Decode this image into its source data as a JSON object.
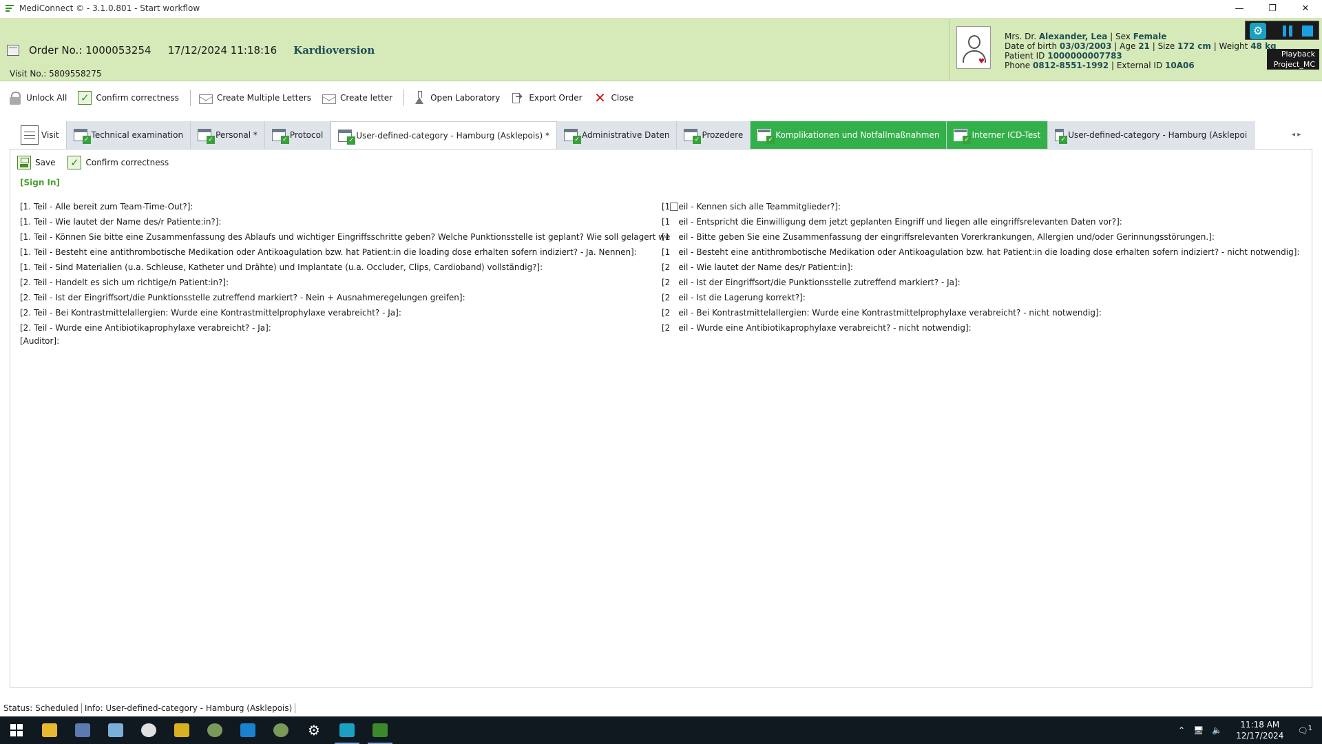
{
  "window": {
    "title": "MediConnect © - 3.1.0.801 - Start workflow",
    "minimize": "—",
    "restore": "❐",
    "close": "✕"
  },
  "order": {
    "number_label": "Order No.: 1000053254",
    "datetime": "17/12/2024 11:18:16",
    "type": "Kardioversion",
    "visit_label": "Visit No.: 5809558275"
  },
  "patient": {
    "title_name_prefix": "Mrs. Dr.",
    "name": "Alexander, Lea",
    "sex_label": "Sex",
    "sex": "Female",
    "dob_label": "Date of birth",
    "dob": "03/03/2003",
    "age_label": "Age",
    "age": "21",
    "size_label": "Size",
    "size": "172 cm",
    "weight_label": "Weight",
    "weight": "48 kg",
    "patient_id_label": "Patient ID",
    "patient_id": "1000000007783",
    "phone_label": "Phone",
    "phone": "0812-8551-1992",
    "external_id_label": "External ID",
    "external_id": "10A06"
  },
  "widget": {
    "playback_label": "Playback",
    "project_label": "Project_MC"
  },
  "toolbar": {
    "unlock_all": "Unlock All",
    "confirm_correctness": "Confirm correctness",
    "create_multiple_letters": "Create Multiple Letters",
    "create_letter": "Create letter",
    "open_laboratory": "Open Laboratory",
    "export_order": "Export Order",
    "close": "Close"
  },
  "tabs": [
    {
      "label": "Visit",
      "state": "normal"
    },
    {
      "label": "Technical examination",
      "state": "normal"
    },
    {
      "label": "Personal *",
      "state": "normal"
    },
    {
      "label": "Protocol",
      "state": "normal"
    },
    {
      "label": "User-defined-category - Hamburg (Asklepois) *",
      "state": "active"
    },
    {
      "label": "Administrative Daten",
      "state": "normal"
    },
    {
      "label": "Prozedere",
      "state": "normal"
    },
    {
      "label": "Komplikationen und Notfallmaßnahmen",
      "state": "green"
    },
    {
      "label": "Interner ICD-Test",
      "state": "green"
    },
    {
      "label": "User-defined-category - Hamburg (Asklepoi",
      "state": "normal"
    }
  ],
  "tab_arrows": "◂ ▸",
  "form": {
    "save": "Save",
    "confirm_correctness": "Confirm correctness",
    "section_title": "[Sign In]",
    "left_items": [
      "[1. Teil - Alle bereit zum Team-Time-Out?]:",
      "[1. Teil - Wie lautet der Name des/r Patiente:in?]:",
      "[1. Teil - Können Sie bitte eine Zusammenfassung des Ablaufs und wichtiger Eingriffsschritte geben? Welche Punktionsstelle ist geplant? Wie soll gelagert werden?]:",
      "[1. Teil - Besteht eine antithrombotische Medikation oder Antikoagulation bzw. hat Patient:in die loading dose erhalten sofern indiziert? - Ja. Nennen]:",
      "[1. Teil - Sind Materialien (u.a. Schleuse, Katheter und Drähte) und Implantate (u.a. Occluder, Clips, Cardioband) vollständig?]:",
      "[2. Teil - Handelt es sich um richtige/n Patient:in?]:",
      "[2. Teil - Ist der Eingriffsort/die Punktionsstelle zutreffend markiert? - Nein + Ausnahmeregelungen greifen]:",
      "[2. Teil - Bei Kontrastmittelallergien: Wurde eine Kontrastmittelprophylaxe verabreicht? - Ja]:",
      "[2. Teil - Wurde eine Antibiotikaprophylaxe verabreicht? - Ja]:"
    ],
    "right_items": [
      {
        "prefix": "[1",
        "text": "eil - Kennen sich alle Teammitglieder?]:"
      },
      {
        "prefix": "[1",
        "text": "eil - Entspricht die Einwilligung dem jetzt geplanten Eingriff und liegen alle eingriffsrelevanten Daten vor?]:"
      },
      {
        "prefix": "[1",
        "text": "eil - Bitte geben Sie eine Zusammenfassung der eingriffsrelevanten Vorerkrankungen, Allergien und/oder Gerinnungsstörungen.]:"
      },
      {
        "prefix": "[1",
        "text": "eil - Besteht eine antithrombotische Medikation oder Antikoagulation bzw. hat Patient:in die loading dose erhalten sofern indiziert? - nicht notwendig]:"
      },
      {
        "prefix": "[2",
        "text": "eil - Wie lautet der Name des/r Patient:in]:"
      },
      {
        "prefix": "[2",
        "text": "eil - Ist der Eingriffsort/die Punktionsstelle zutreffend markiert? - Ja]:"
      },
      {
        "prefix": "[2",
        "text": "eil - Ist die Lagerung korrekt?]:"
      },
      {
        "prefix": "[2",
        "text": "eil - Bei Kontrastmittelallergien: Wurde eine Kontrastmittelprophylaxe verabreicht? - nicht notwendig]:"
      },
      {
        "prefix": "[2",
        "text": "eil - Wurde eine Antibiotikaprophylaxe verabreicht? - nicht notwendig]:"
      }
    ],
    "auditor": "[Auditor]:"
  },
  "status": {
    "status": "Status: Scheduled",
    "info": "Info: User-defined-category - Hamburg (Asklepois)"
  },
  "taskbar": {
    "time": "11:18 AM",
    "date": "12/17/2024",
    "notification_count": "1"
  },
  "colors": {
    "header_bg": "#d6e9b8",
    "accent_green": "#33b04a",
    "section_green": "#4aa02a",
    "value_teal": "#1e4e56",
    "taskbar_bg": "#101820"
  }
}
